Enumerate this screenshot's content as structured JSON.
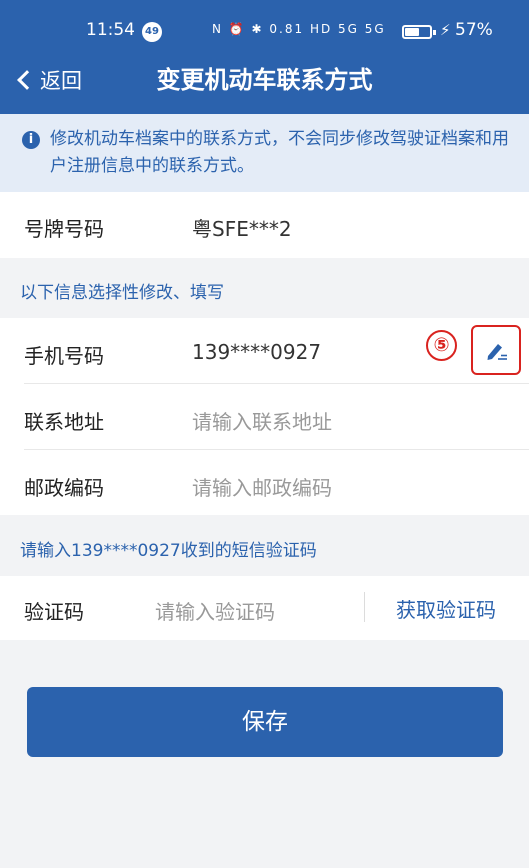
{
  "status_bar": {
    "time": "11:54",
    "notification_count": "49",
    "icons_text": "N ⏰ ✱ 0.81 HD 5G 5G",
    "battery_percent": "57%"
  },
  "nav": {
    "back_label": "返回",
    "title": "变更机动车联系方式"
  },
  "notice": {
    "text": "修改机动车档案中的联系方式，不会同步修改驾驶证档案和用户注册信息中的联系方式。"
  },
  "plate": {
    "label": "号牌号码",
    "value": "粤SFE***2"
  },
  "optional_section": {
    "label": "以下信息选择性修改、填写"
  },
  "phone": {
    "label": "手机号码",
    "value": "139****0927"
  },
  "annotation": {
    "step": "⑤"
  },
  "address": {
    "label": "联系地址",
    "placeholder": "请输入联系地址"
  },
  "postcode": {
    "label": "邮政编码",
    "placeholder": "请输入邮政编码"
  },
  "sms_section": {
    "label": "请输入139****0927收到的短信验证码"
  },
  "verify": {
    "label": "验证码",
    "placeholder": "请输入验证码",
    "get_code": "获取验证码"
  },
  "save_label": "保存",
  "colors": {
    "primary": "#2b62ad",
    "notice_bg": "#e4ecf7",
    "annotation_red": "#d9231f"
  }
}
